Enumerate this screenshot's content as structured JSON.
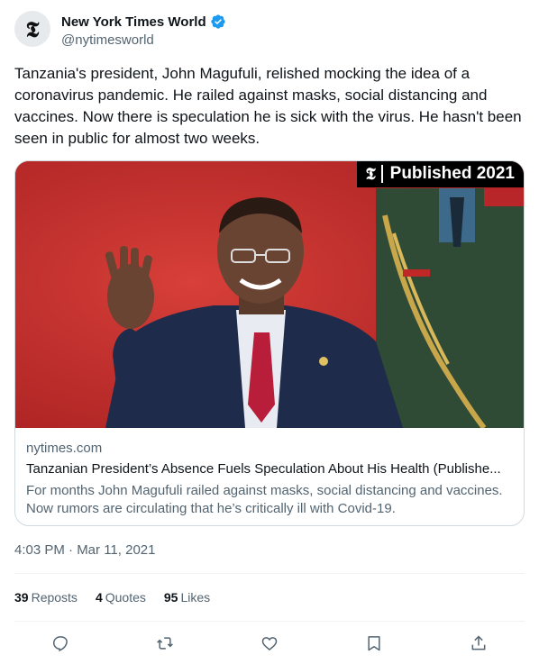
{
  "account": {
    "display_name": "New York Times World",
    "handle": "@nytimesworld",
    "avatar_glyph": "𝕿"
  },
  "tweet": {
    "text": "Tanzania's president, John Magufuli, relished mocking the idea of a coronavirus pandemic. He railed against masks, social distancing and vaccines. Now there is speculation he is sick with the virus. He hasn't been seen in public for almost two weeks.",
    "timestamp": "4:03 PM · Mar 11, 2021"
  },
  "card": {
    "badge_text": "Published 2021",
    "badge_logo": "𝕿",
    "domain": "nytimes.com",
    "title": "Tanzanian President’s Absence Fuels Speculation About His Health (Publishe...",
    "description": "For months John Magufuli railed against masks, social distancing and vaccines. Now rumors are circulating that he’s critically ill with Covid-19."
  },
  "stats": {
    "reposts_count": "39",
    "reposts_label": "Reposts",
    "quotes_count": "4",
    "quotes_label": "Quotes",
    "likes_count": "95",
    "likes_label": "Likes"
  },
  "icons": {
    "reply": "reply-icon",
    "repost": "repost-icon",
    "like": "heart-icon",
    "bookmark": "bookmark-icon",
    "share": "share-icon",
    "verified": "verified-badge-icon"
  },
  "colors": {
    "verified_blue": "#1d9bf0",
    "muted_text": "#536471",
    "photo_background": "#c72c2c"
  }
}
